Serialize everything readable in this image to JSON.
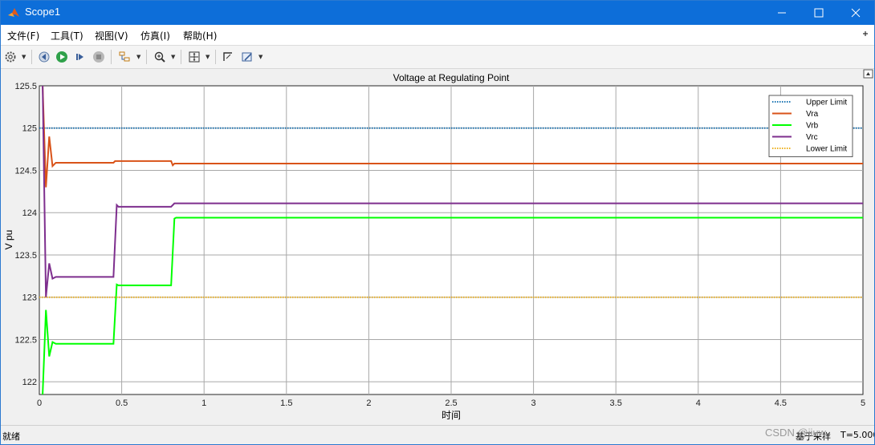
{
  "window": {
    "title": "Scope1"
  },
  "menu": [
    {
      "label": "文件(F)"
    },
    {
      "label": "工具(T)"
    },
    {
      "label": "视图(V)"
    },
    {
      "label": "仿真(I)"
    },
    {
      "label": "帮助(H)"
    }
  ],
  "toolbar": {
    "icons": [
      "gear-icon",
      "step-back-icon",
      "run-icon",
      "step-forward-icon",
      "stop-icon",
      "highlight-icon",
      "zoom-icon",
      "autoscale-icon",
      "cursor-measure-icon",
      "style-icon"
    ]
  },
  "status": {
    "left": "就绪",
    "sample": "基于采样",
    "time": "T=5.000"
  },
  "watermark": "CSDN @jiuw",
  "colors": {
    "titlebar": "#0d6ed9",
    "upper": "#1f77b4",
    "vra": "#d95319",
    "vrb": "#00ff00",
    "vrc": "#7e2f8e",
    "lower": "#edb120"
  },
  "chart_data": {
    "type": "line",
    "title": "Voltage at Regulating Point",
    "xlabel": "时间",
    "ylabel": "V pu",
    "xlim": [
      0,
      5
    ],
    "ylim": [
      121.85,
      125.5
    ],
    "xticks": [
      "0",
      "0.5",
      "1",
      "1.5",
      "2",
      "2.5",
      "3",
      "3.5",
      "4",
      "4.5",
      "5"
    ],
    "yticks": [
      "122",
      "122.5",
      "123",
      "123.5",
      "124",
      "124.5",
      "125",
      "125.5"
    ],
    "grid": true,
    "legend_position": "top-right",
    "series": [
      {
        "name": "Upper Limit",
        "color": "#1f77b4",
        "style": "dotted",
        "x": [
          0,
          5
        ],
        "y": [
          125,
          125
        ]
      },
      {
        "name": "Vra",
        "color": "#d95319",
        "style": "solid",
        "x": [
          0.02,
          0.04,
          0.06,
          0.08,
          0.1,
          0.45,
          0.46,
          0.8,
          0.81,
          0.82,
          5
        ],
        "y": [
          125.5,
          124.3,
          124.9,
          124.55,
          124.59,
          124.59,
          124.61,
          124.61,
          124.56,
          124.58,
          124.58
        ]
      },
      {
        "name": "Vrb",
        "color": "#00ff00",
        "style": "solid",
        "x": [
          0.02,
          0.04,
          0.06,
          0.08,
          0.1,
          0.45,
          0.47,
          0.48,
          0.8,
          0.82,
          0.83,
          5
        ],
        "y": [
          121.85,
          122.85,
          122.3,
          122.47,
          122.45,
          122.45,
          123.15,
          123.14,
          123.14,
          123.93,
          123.94,
          123.94
        ]
      },
      {
        "name": "Vrc",
        "color": "#7e2f8e",
        "style": "solid",
        "x": [
          0.02,
          0.04,
          0.06,
          0.08,
          0.1,
          0.45,
          0.47,
          0.48,
          0.8,
          0.82,
          0.83,
          5
        ],
        "y": [
          125.5,
          123.0,
          123.4,
          123.22,
          123.24,
          123.24,
          124.09,
          124.07,
          124.07,
          124.11,
          124.11,
          124.11
        ]
      },
      {
        "name": "Lower Limit",
        "color": "#edb120",
        "style": "dotted",
        "x": [
          0,
          5
        ],
        "y": [
          123,
          123
        ]
      }
    ]
  }
}
